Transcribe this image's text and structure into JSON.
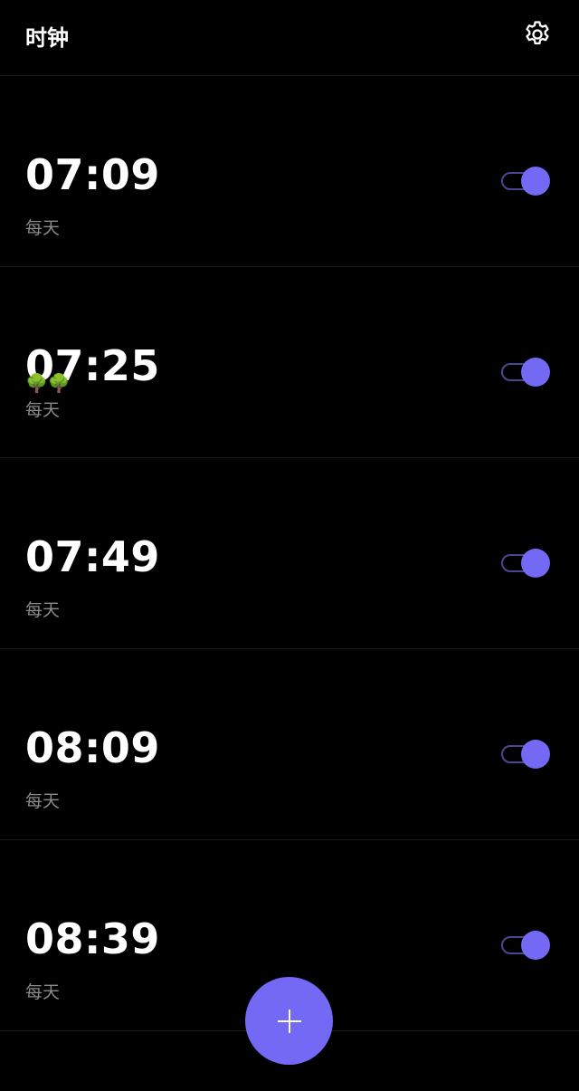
{
  "header": {
    "title": "时钟",
    "settings_icon": "gear-icon"
  },
  "alarms": [
    {
      "time": "07:09",
      "note": "",
      "repeat": "每天",
      "enabled": true
    },
    {
      "time": "07:25",
      "note": "🌳🌳",
      "repeat": "每天",
      "enabled": true
    },
    {
      "time": "07:49",
      "note": "",
      "repeat": "每天",
      "enabled": true
    },
    {
      "time": "08:09",
      "note": "",
      "repeat": "每天",
      "enabled": true
    },
    {
      "time": "08:39",
      "note": "",
      "repeat": "每天",
      "enabled": true
    }
  ],
  "fab": {
    "icon": "plus-icon"
  },
  "colors": {
    "background": "#000000",
    "accent": "#7469f4",
    "toggle_track": "#4a4691",
    "secondary_text": "#8a8a8a"
  }
}
